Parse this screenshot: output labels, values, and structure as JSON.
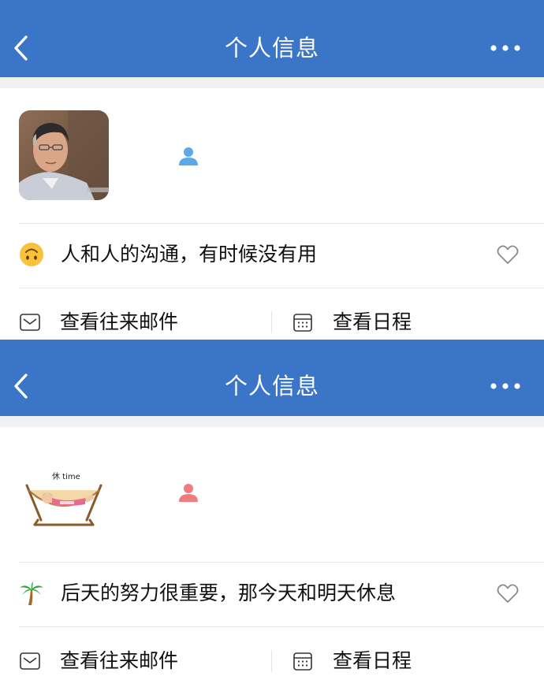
{
  "screens": [
    {
      "navbar": {
        "title": "个人信息",
        "back_icon": "chevron-left-icon",
        "more_icon": "more-dots-icon"
      },
      "profile": {
        "avatar": "avatar-photo-middle-aged-man",
        "gender_icon": "person-icon",
        "gender_color": "#5aa9ea"
      },
      "status": {
        "emoji": "upside-down-face-icon",
        "text": "人和人的沟通，有时候没有用",
        "like_icon": "heart-outline-icon"
      },
      "actions": [
        {
          "label": "查看往来邮件",
          "icon": "mail-icon"
        },
        {
          "label": "查看日程",
          "icon": "calendar-icon"
        }
      ]
    },
    {
      "navbar": {
        "title": "个人信息",
        "back_icon": "chevron-left-icon",
        "more_icon": "more-dots-icon"
      },
      "profile": {
        "avatar": "avatar-hammock-illustration",
        "avatar_text": "休 time",
        "gender_icon": "person-icon",
        "gender_color": "#ef7d80"
      },
      "status": {
        "emoji": "palm-tree-icon",
        "text": "后天的努力很重要，那今天和明天休息",
        "like_icon": "heart-outline-icon"
      },
      "actions": [
        {
          "label": "查看往来邮件",
          "icon": "mail-icon"
        },
        {
          "label": "查看日程",
          "icon": "calendar-icon"
        }
      ]
    }
  ],
  "colors": {
    "navbar": "#3a75c7",
    "background": "#f1f0f3",
    "card": "#ffffff"
  }
}
